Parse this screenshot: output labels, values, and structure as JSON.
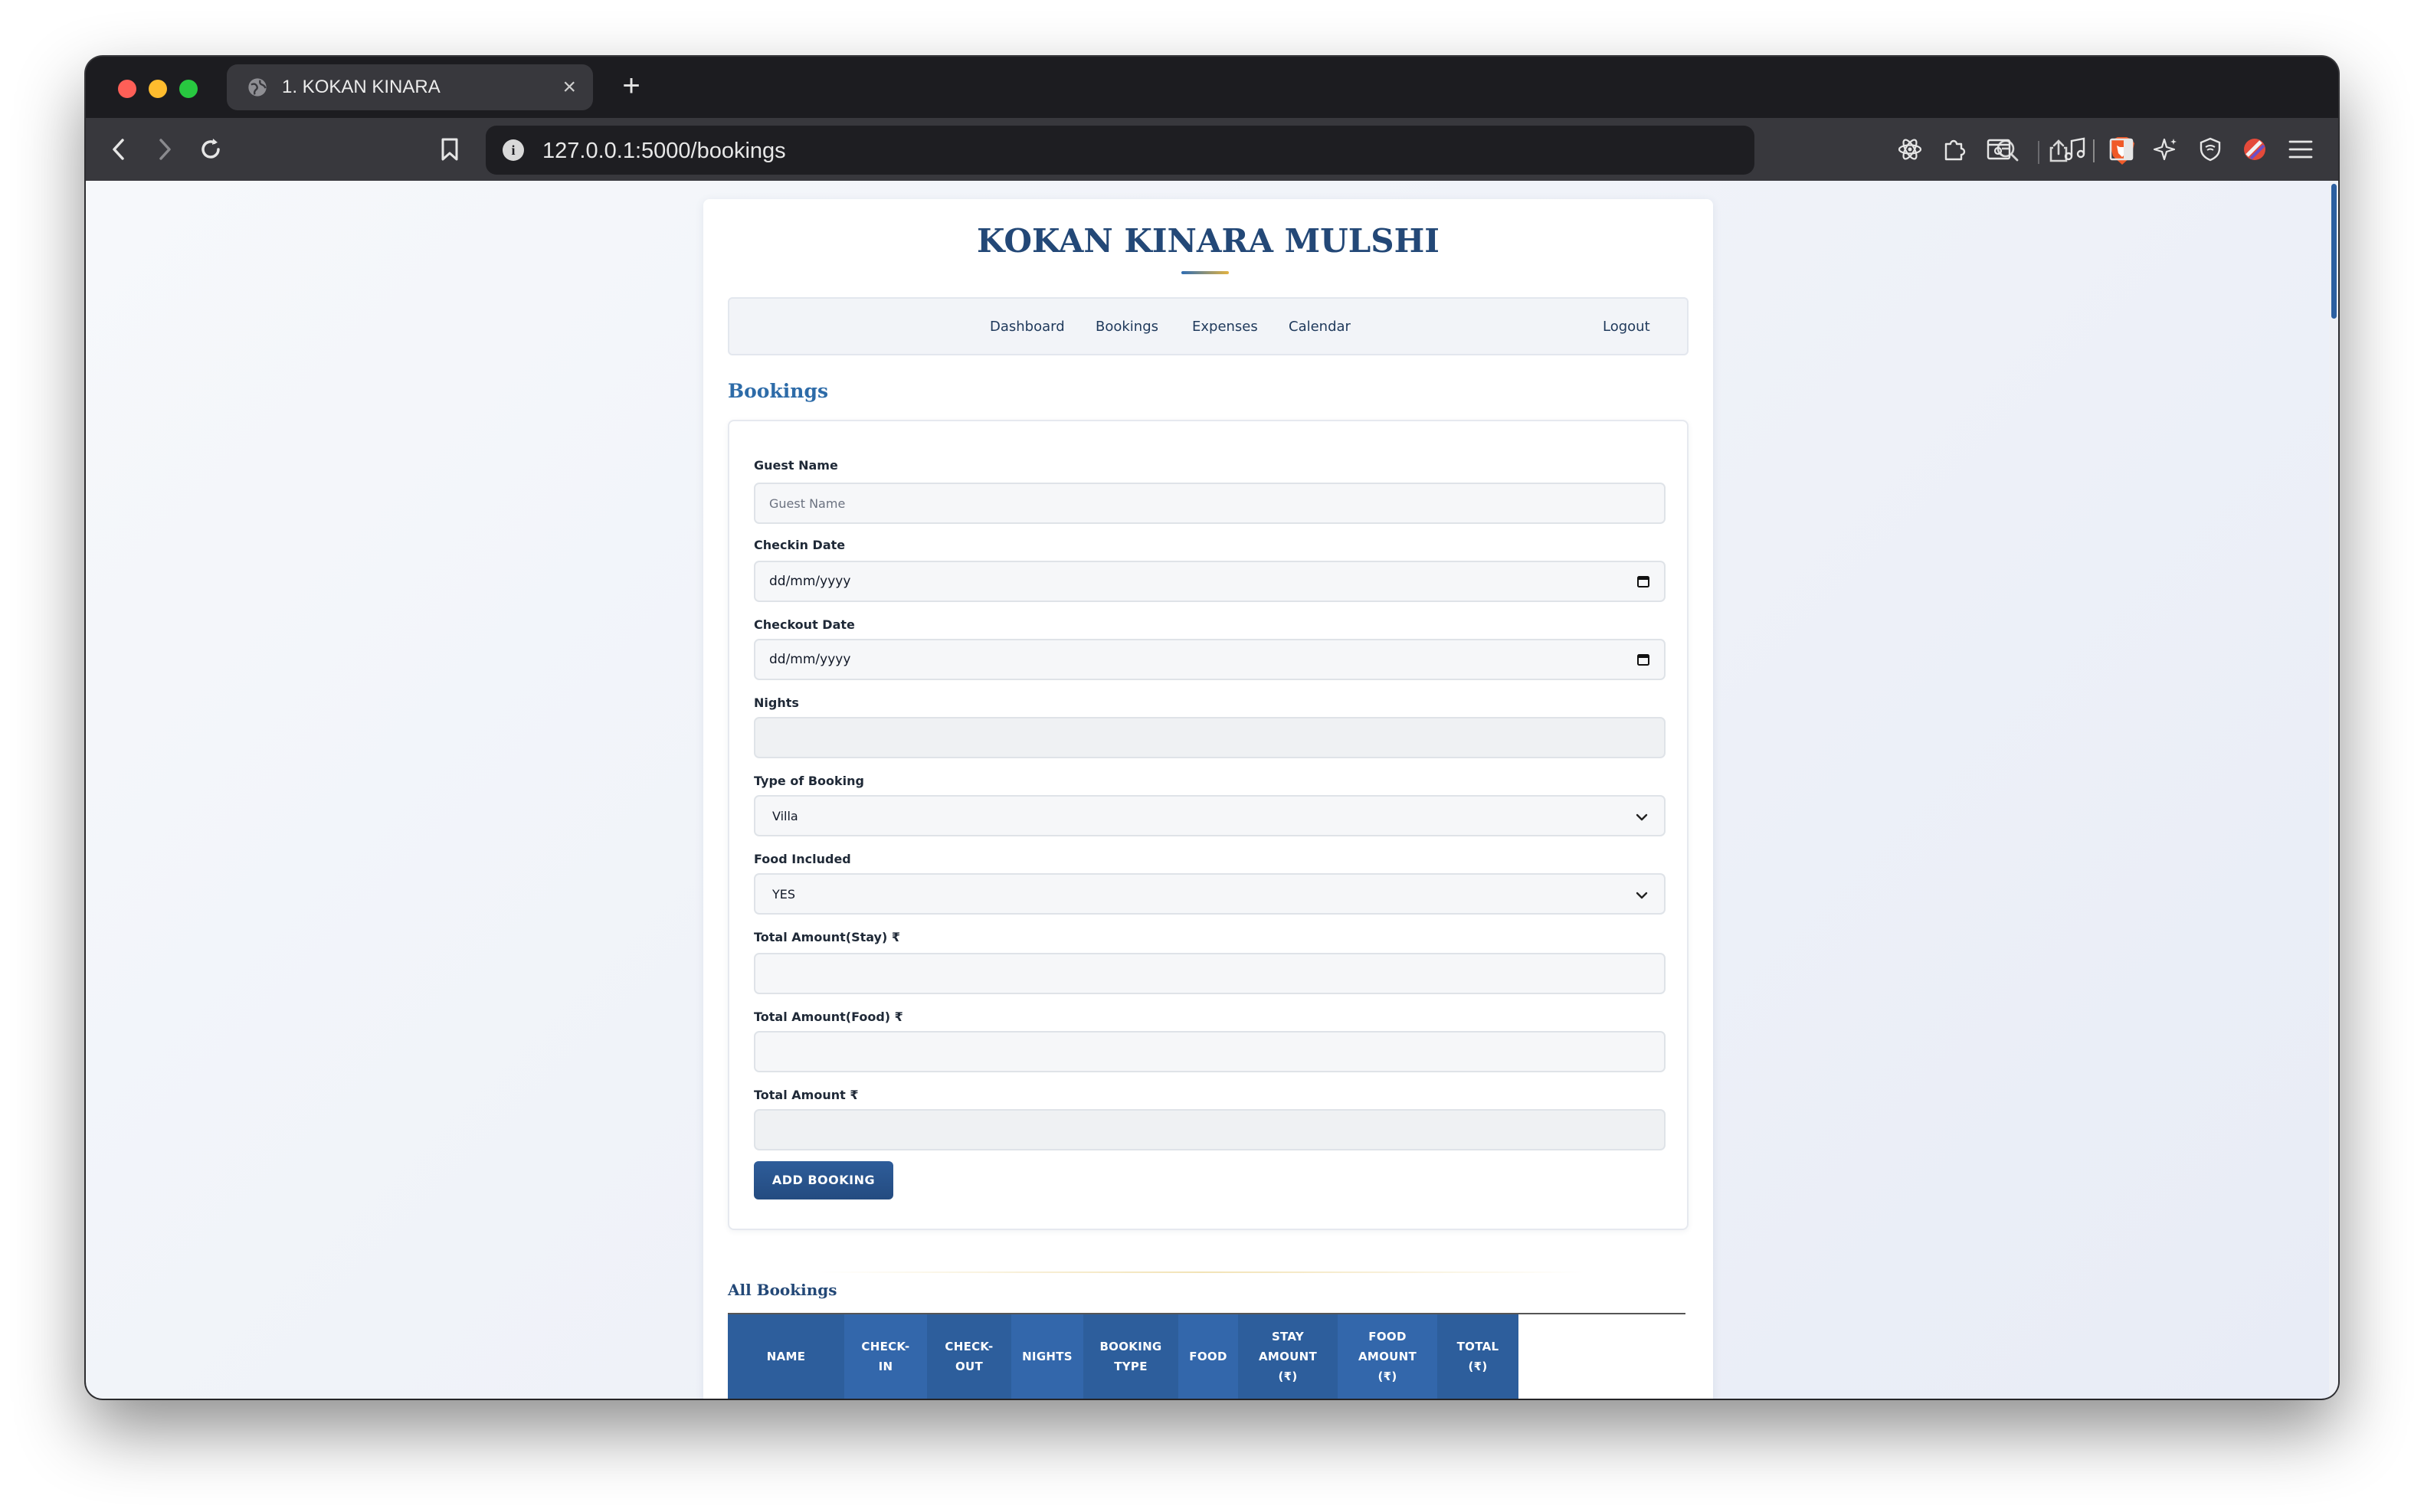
{
  "browser": {
    "tab_title": "1. KOKAN KINARA",
    "tab_close": "×",
    "new_tab": "+",
    "url": "127.0.0.1:5000/bookings",
    "info_icon": "i"
  },
  "page": {
    "brand": "KOKAN KINARA MULSHI",
    "nav": {
      "dashboard": "Dashboard",
      "bookings": "Bookings",
      "expenses": "Expenses",
      "calendar": "Calendar",
      "logout": "Logout"
    },
    "section_title": "Bookings",
    "form": {
      "guest_name_label": "Guest Name",
      "guest_name_placeholder": "Guest Name",
      "checkin_label": "Checkin Date",
      "checkin_value": "dd/mm/yyyy",
      "checkout_label": "Checkout Date",
      "checkout_value": "dd/mm/yyyy",
      "nights_label": "Nights",
      "nights_value": "",
      "booking_type_label": "Type of Booking",
      "booking_type_value": "Villa",
      "food_label": "Food Included",
      "food_value": "YES",
      "stay_amount_label": "Total Amount(Stay) ₹",
      "stay_amount_value": "",
      "food_amount_label": "Total Amount(Food) ₹",
      "food_amount_value": "",
      "total_label": "Total Amount ₹",
      "total_value": "",
      "submit_label": "ADD BOOKING"
    },
    "all_bookings_title": "All Bookings",
    "table_headers": [
      "NAME",
      "CHECK-\nIN",
      "CHECK-\nOUT",
      "NIGHTS",
      "BOOKING\nTYPE",
      "FOOD",
      "STAY\nAMOUNT\n(₹)",
      "FOOD\nAMOUNT\n(₹)",
      "TOTAL\n(₹)"
    ]
  },
  "colors": {
    "brand_navy": "#234877",
    "accent_blue": "#2d6ba8",
    "button_blue": "#2e5d9a",
    "brave_orange": "#f05a28"
  },
  "icons": {
    "back": "chevron-left-icon",
    "forward": "chevron-right-icon",
    "reload": "reload-icon",
    "bookmark": "bookmark-icon",
    "zoom": "zoom-out-icon",
    "share": "share-icon",
    "brave": "brave-lion-icon"
  }
}
